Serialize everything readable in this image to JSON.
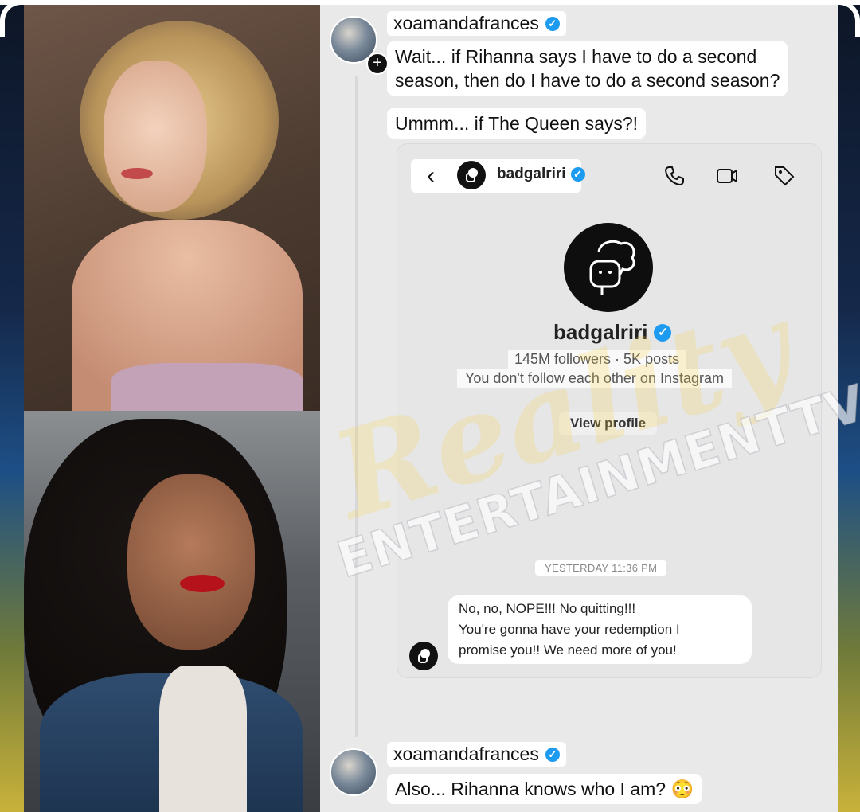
{
  "post": {
    "username": "xoamandafrances",
    "message_1": "Wait... if Rihanna says I have to do a second\nseason, then do I have to do a second season?",
    "message_2": "Ummm... if The Queen says?!",
    "reply_username": "xoamandafrances",
    "reply_message": "Also... Rihanna knows who I am? 😳"
  },
  "dm_screenshot": {
    "header_username": "badgalriri",
    "back_icon": "chevron-left-icon",
    "icons": [
      "phone-icon",
      "video-icon",
      "tag-icon"
    ],
    "profile_name": "badgalriri",
    "stats": "145M followers · 5K posts",
    "follow_note": "You don't follow each other on Instagram",
    "view_profile_label": "View profile",
    "timestamp": "YESTERDAY 11:36 PM",
    "message": "No, no, NOPE!!! No quitting!!!\nYou're gonna have your redemption I\npromise you!! We need more of you!"
  },
  "watermark": {
    "script": "Reality",
    "main": "ENTERTAINMENTTV"
  },
  "colors": {
    "verified": "#1d9bf0",
    "panel_bg": "#e9e9ea"
  }
}
